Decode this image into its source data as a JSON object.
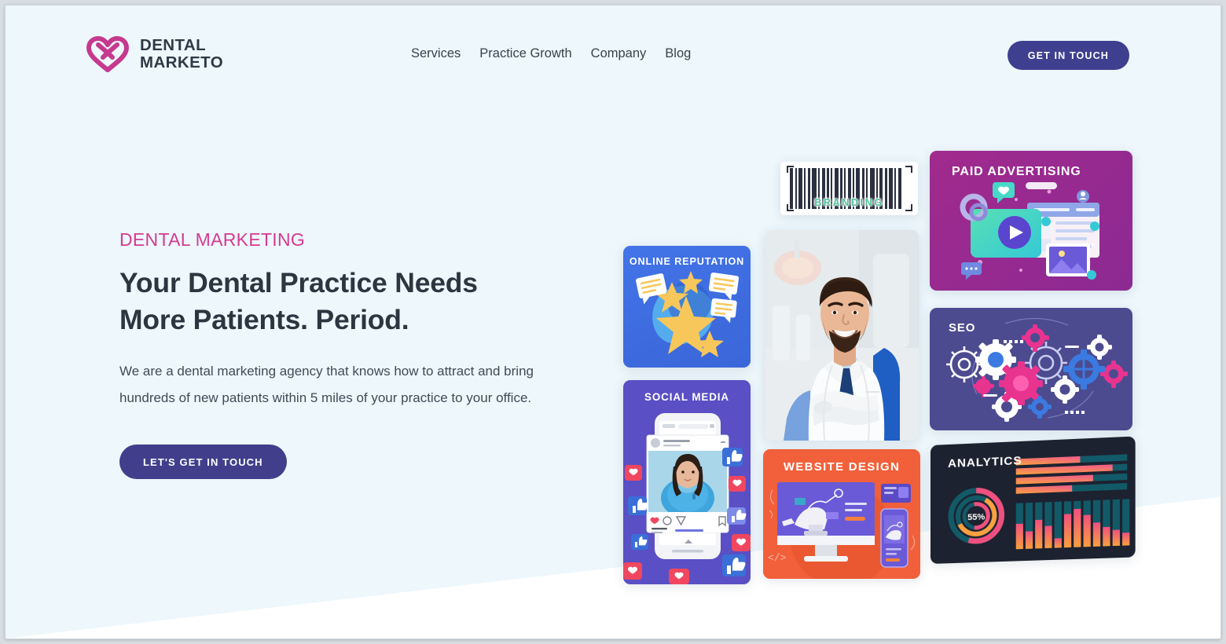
{
  "brand": {
    "logo_icon": "heart-logo-icon",
    "name_line1": "DENTAL",
    "name_line2": "MARKETO",
    "accent_pink": "#d53a92",
    "accent_indigo": "#3f3f8f"
  },
  "nav": {
    "items": [
      {
        "label": "Services"
      },
      {
        "label": "Practice Growth"
      },
      {
        "label": "Company"
      },
      {
        "label": "Blog"
      }
    ],
    "cta_label": "GET IN TOUCH"
  },
  "hero": {
    "eyebrow": "DENTAL MARKETING",
    "headline_line1": "Your Dental Practice Needs",
    "headline_line2": "More Patients. Period.",
    "subcopy": "We are a dental marketing agency that knows how to attract and bring hundreds of new patients within 5 miles of your practice to your office.",
    "cta_label": "LET'S GET IN TOUCH"
  },
  "collage": {
    "cards": [
      {
        "id": "branding",
        "title": "BRANDING",
        "color": "#ffffff",
        "icon": "barcode-icon"
      },
      {
        "id": "paid",
        "title": "PAID ADVERTISING",
        "color": "#a12a8d",
        "icon": "video-player-icon"
      },
      {
        "id": "seo",
        "title": "SEO",
        "color": "#4c4b90",
        "icon": "gears-icon"
      },
      {
        "id": "analytics",
        "title": "ANALYTICS",
        "color": "#1d2230",
        "icon": "charts-icon",
        "donut_label": "55%"
      },
      {
        "id": "reputation",
        "title": "ONLINE REPUTATION",
        "color": "#4274e8",
        "icon": "stars-reviews-icon"
      },
      {
        "id": "social",
        "title": "SOCIAL MEDIA",
        "color": "#5a4fc4",
        "icon": "phone-likes-icon"
      },
      {
        "id": "website",
        "title": "WEBSITE DESIGN",
        "color": "#f1603b",
        "icon": "monitor-phone-icon"
      },
      {
        "id": "dentist",
        "title": "",
        "color": "#dfe6ea",
        "icon": "dentist-photo"
      }
    ],
    "analytics_chart": {
      "type": "bar",
      "donut_percent": 55,
      "donut_label": "55%",
      "hbars": [
        62,
        88,
        70,
        52
      ],
      "vbars": [
        46,
        30,
        52,
        40,
        18,
        62,
        70,
        58,
        44,
        36,
        30,
        26
      ]
    }
  }
}
